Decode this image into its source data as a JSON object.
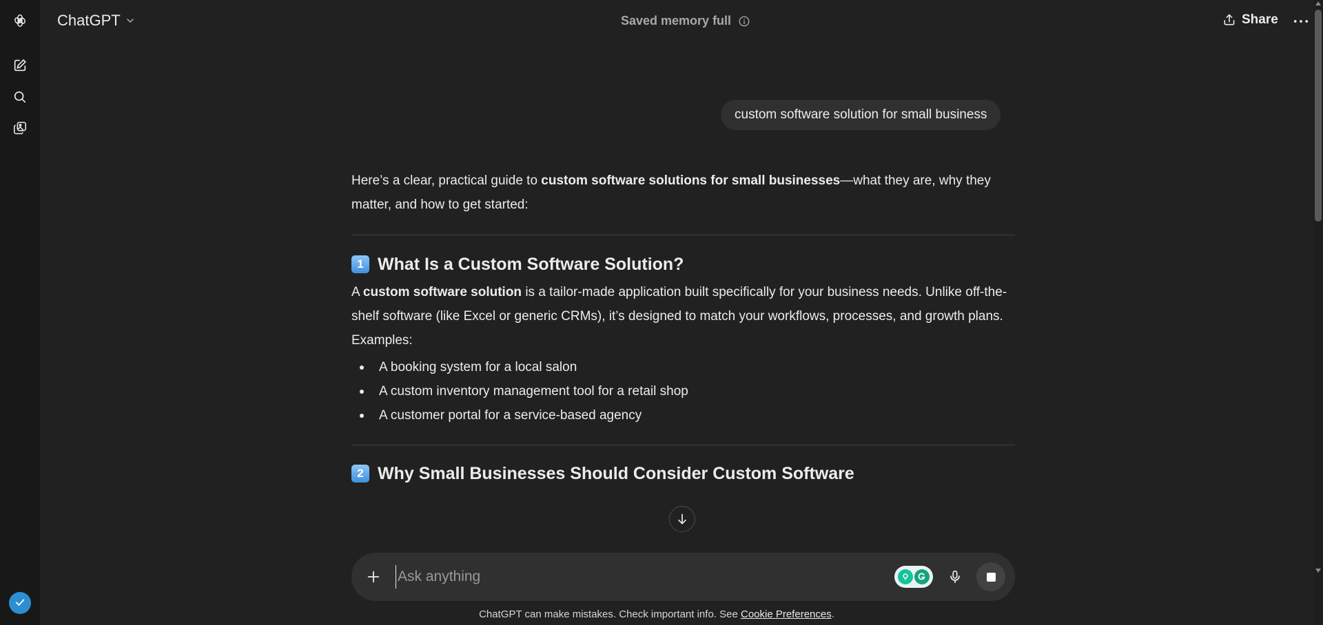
{
  "header": {
    "model_name": "ChatGPT",
    "memory_status": "Saved memory full",
    "share_label": "Share"
  },
  "user_message": "custom software solution for small business",
  "answer": {
    "intro_before": "Here’s a clear, practical guide to ",
    "intro_bold": "custom software solutions for small businesses",
    "intro_after": "—what they are, why they matter, and how to get started:",
    "section1": {
      "number": "1",
      "heading": "What Is a Custom Software Solution?",
      "p_before": "A ",
      "p_bold": "custom software solution",
      "p_after": " is a tailor-made application built specifically for your business needs. Unlike off-the-shelf software (like Excel or generic CRMs), it’s designed to match your workflows, processes, and growth plans.",
      "examples_label": "Examples:",
      "examples": [
        "A booking system for a local salon",
        "A custom inventory management tool for a retail shop",
        "A customer portal for a service-based agency"
      ]
    },
    "section2": {
      "number": "2",
      "heading": "Why Small Businesses Should Consider Custom Software"
    }
  },
  "composer": {
    "placeholder": "Ask anything"
  },
  "footer": {
    "disclaimer_text": "ChatGPT can make mistakes. Check important info. See ",
    "cookie_link": "Cookie Preferences",
    "disclaimer_end": "."
  },
  "colors": {
    "background": "#212121",
    "sidebar": "#181818",
    "bubble": "#303030",
    "text": "#ececec",
    "muted": "#a8a8a8"
  }
}
